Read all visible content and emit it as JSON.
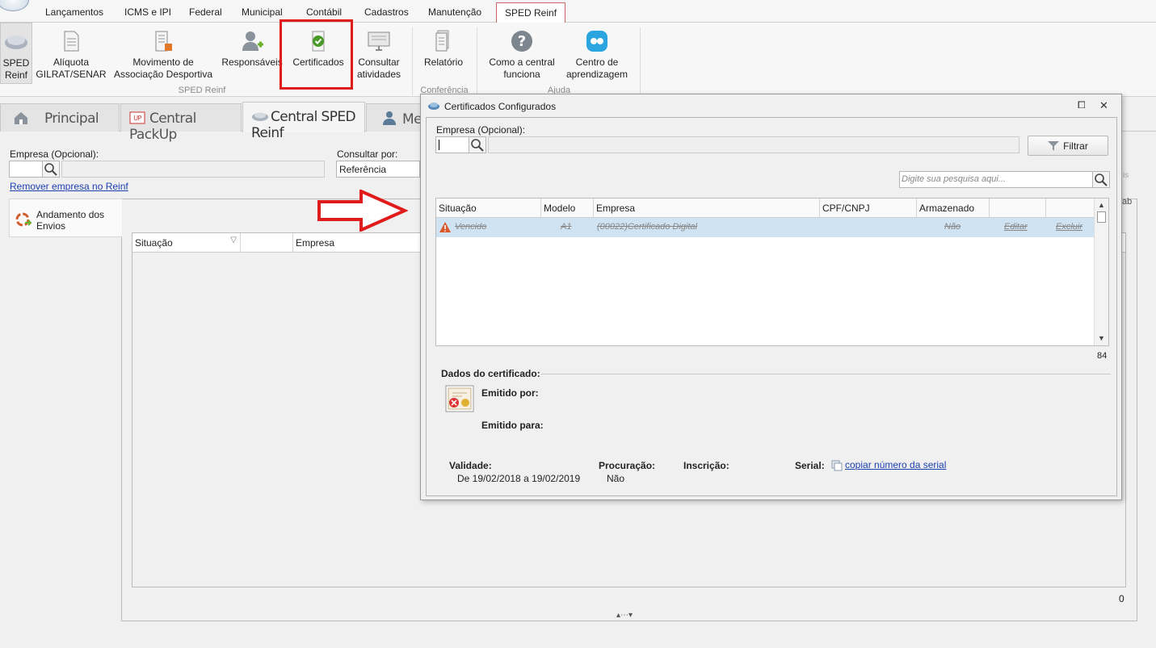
{
  "menu": {
    "tabs": [
      "Lançamentos",
      "ICMS e IPI",
      "Federal",
      "Municipal",
      "Contábil",
      "Cadastros",
      "Manutenção",
      "SPED Reinf"
    ]
  },
  "ribbon": {
    "buttons": {
      "sped_reinf": "SPED\nReinf",
      "aliquota": "Alíquota\nGILRAT/SENAR",
      "movimento": "Movimento de\nAssociação Desportiva",
      "responsaveis": "Responsáveis",
      "certificados": "Certificados",
      "consultar": "Consultar\natividades",
      "relatorio": "Relatório",
      "como": "Como a central\nfunciona",
      "centro": "Centro de\naprendizagem"
    },
    "groups": {
      "sped_reinf": "SPED Reinf",
      "conferencia": "Conferência",
      "ajuda": "Ajuda"
    }
  },
  "page_tabs": [
    "Principal",
    "Central PackUp",
    "Central SPED Reinf",
    "Me"
  ],
  "main": {
    "empresa_label": "Empresa (Opcional):",
    "consultar_label": "Consultar por:",
    "consultar_value": "Referência",
    "remover_link": "Remover empresa no Reinf",
    "andamento": "Andamento dos\nEnvios",
    "grid_headers": [
      "Situação",
      "",
      "Empresa"
    ],
    "count": "0",
    "right_clip_1": "is",
    "right_clip_2": "ab"
  },
  "dialog": {
    "title": "Certificados Configurados",
    "empresa_label": "Empresa (Opcional):",
    "filtrar": "Filtrar",
    "search_placeholder": "Digite sua pesquisa aqui...",
    "headers": [
      "Situação",
      "Modelo",
      "Empresa",
      "CPF/CNPJ",
      "Armazenado"
    ],
    "row": {
      "situacao": "Vencido",
      "modelo": "A1",
      "empresa": "(00022)Certificado Digital",
      "armazenado": "Não",
      "editar": "Editar",
      "excluir": "Excluir"
    },
    "count": "84",
    "dados_title": "Dados do certificado:",
    "emitido_por": "Emitido por:",
    "emitido_para": "Emitido para:",
    "validade_label": "Validade:",
    "validade_value": "De 19/02/2018 a 19/02/2019",
    "procuracao_label": "Procuração:",
    "procuracao_value": "Não",
    "inscricao_label": "Inscrição:",
    "serial_label": "Serial:",
    "serial_link": "copiar número da serial"
  },
  "colors": {
    "highlight": "#e01b1b",
    "arrow": "#e01b1b",
    "selected_row": "#cfe3f3",
    "link": "#1a3fb0"
  }
}
